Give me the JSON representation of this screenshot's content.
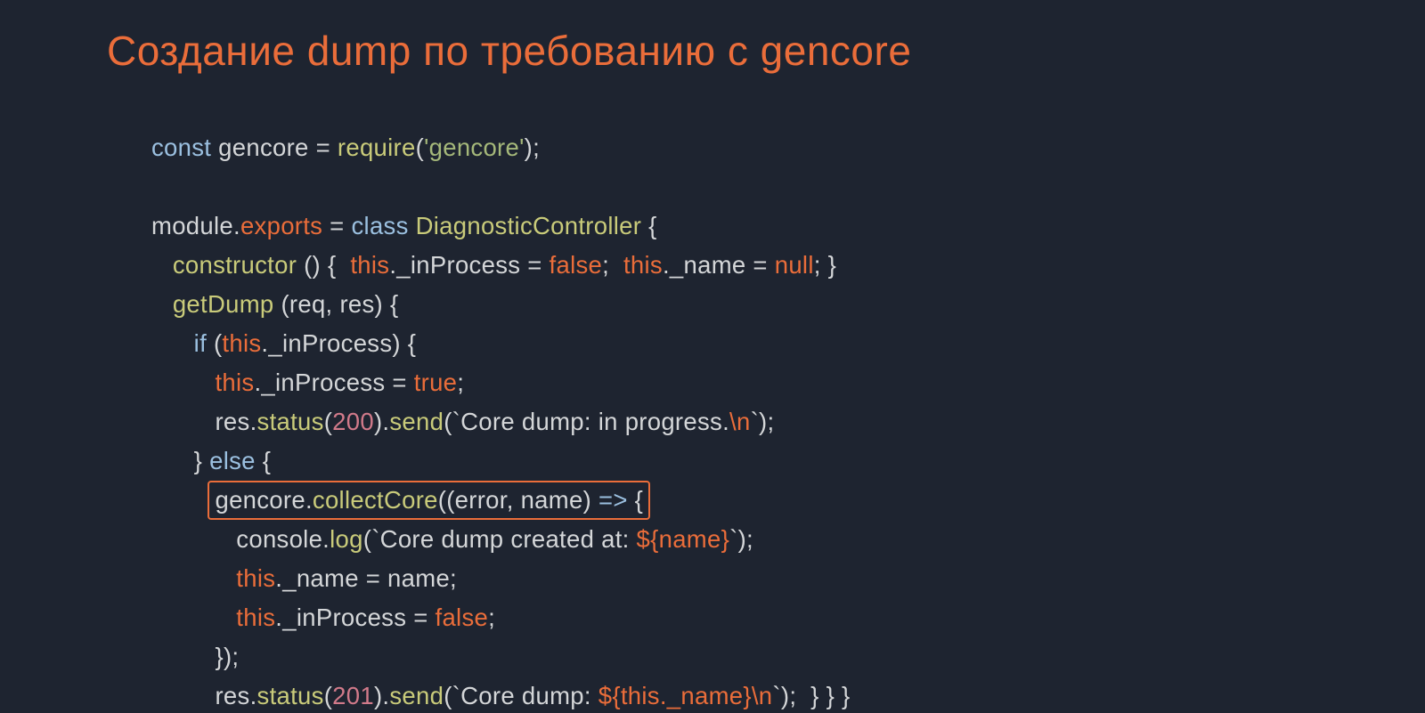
{
  "title": "Создание dump по требованию с gencore",
  "colors": {
    "bg": "#1e2430",
    "accent": "#ea6d3a",
    "keyword": "#9bc0e0",
    "function": "#c9cb7a",
    "number": "#d17a8a",
    "string": "#a5b87a",
    "text": "#d4d6d8"
  },
  "highlight_box_line_index": 9,
  "code_lines": [
    {
      "indent": 0,
      "tokens": [
        {
          "t": "const ",
          "c": "kw"
        },
        {
          "t": "gencore = ",
          "c": "id"
        },
        {
          "t": "require",
          "c": "fn"
        },
        {
          "t": "(",
          "c": "id"
        },
        {
          "t": "'gencore'",
          "c": "strlit"
        },
        {
          "t": ");",
          "c": "id"
        }
      ]
    },
    {
      "indent": 0,
      "tokens": []
    },
    {
      "indent": 0,
      "tokens": [
        {
          "t": "module",
          "c": "mod"
        },
        {
          "t": ".",
          "c": "id"
        },
        {
          "t": "exports",
          "c": "exp"
        },
        {
          "t": " = ",
          "c": "id"
        },
        {
          "t": "class ",
          "c": "kw"
        },
        {
          "t": "DiagnosticController",
          "c": "fn"
        },
        {
          "t": " {",
          "c": "id"
        }
      ]
    },
    {
      "indent": 1,
      "tokens": [
        {
          "t": "constructor",
          "c": "fn"
        },
        {
          "t": " () {  ",
          "c": "id"
        },
        {
          "t": "this",
          "c": "this"
        },
        {
          "t": "._inProcess = ",
          "c": "id"
        },
        {
          "t": "false",
          "c": "bool"
        },
        {
          "t": ";  ",
          "c": "id"
        },
        {
          "t": "this",
          "c": "this"
        },
        {
          "t": "._name = ",
          "c": "id"
        },
        {
          "t": "null",
          "c": "bool"
        },
        {
          "t": "; }",
          "c": "id"
        }
      ]
    },
    {
      "indent": 1,
      "tokens": [
        {
          "t": "getDump",
          "c": "fn"
        },
        {
          "t": " (req, res) {",
          "c": "id"
        }
      ]
    },
    {
      "indent": 2,
      "tokens": [
        {
          "t": "if ",
          "c": "kw"
        },
        {
          "t": "(",
          "c": "id"
        },
        {
          "t": "this",
          "c": "this"
        },
        {
          "t": "._inProcess) {",
          "c": "id"
        }
      ]
    },
    {
      "indent": 3,
      "tokens": [
        {
          "t": "this",
          "c": "this"
        },
        {
          "t": "._inProcess = ",
          "c": "id"
        },
        {
          "t": "true",
          "c": "bool"
        },
        {
          "t": ";",
          "c": "id"
        }
      ]
    },
    {
      "indent": 3,
      "tokens": [
        {
          "t": "res.",
          "c": "id"
        },
        {
          "t": "status",
          "c": "fn"
        },
        {
          "t": "(",
          "c": "id"
        },
        {
          "t": "200",
          "c": "num"
        },
        {
          "t": ").",
          "c": "id"
        },
        {
          "t": "send",
          "c": "fn"
        },
        {
          "t": "(",
          "c": "id"
        },
        {
          "t": "`Core dump: in progress.",
          "c": "str"
        },
        {
          "t": "\\n",
          "c": "esc"
        },
        {
          "t": "`",
          "c": "str"
        },
        {
          "t": ");",
          "c": "id"
        }
      ]
    },
    {
      "indent": 2,
      "tokens": [
        {
          "t": "} ",
          "c": "id"
        },
        {
          "t": "else",
          "c": "kw"
        },
        {
          "t": " {",
          "c": "id"
        }
      ]
    },
    {
      "indent": 3,
      "boxed": true,
      "tokens": [
        {
          "t": "gencore.",
          "c": "id"
        },
        {
          "t": "collectCore",
          "c": "fn"
        },
        {
          "t": "((error, name) ",
          "c": "id"
        },
        {
          "t": "=>",
          "c": "kw"
        },
        {
          "t": " {",
          "c": "id"
        }
      ]
    },
    {
      "indent": 4,
      "tokens": [
        {
          "t": "console.",
          "c": "id"
        },
        {
          "t": "log",
          "c": "fn"
        },
        {
          "t": "(",
          "c": "id"
        },
        {
          "t": "`Core dump created at: ",
          "c": "str"
        },
        {
          "t": "${name}",
          "c": "interp"
        },
        {
          "t": "`",
          "c": "str"
        },
        {
          "t": ");",
          "c": "id"
        }
      ]
    },
    {
      "indent": 4,
      "tokens": [
        {
          "t": "this",
          "c": "this"
        },
        {
          "t": "._name = name;",
          "c": "id"
        }
      ]
    },
    {
      "indent": 4,
      "tokens": [
        {
          "t": "this",
          "c": "this"
        },
        {
          "t": "._inProcess = ",
          "c": "id"
        },
        {
          "t": "false",
          "c": "bool"
        },
        {
          "t": ";",
          "c": "id"
        }
      ]
    },
    {
      "indent": 3,
      "tokens": [
        {
          "t": "});",
          "c": "id"
        }
      ]
    },
    {
      "indent": 3,
      "tokens": [
        {
          "t": "res.",
          "c": "id"
        },
        {
          "t": "status",
          "c": "fn"
        },
        {
          "t": "(",
          "c": "id"
        },
        {
          "t": "201",
          "c": "num"
        },
        {
          "t": ").",
          "c": "id"
        },
        {
          "t": "send",
          "c": "fn"
        },
        {
          "t": "(",
          "c": "id"
        },
        {
          "t": "`Core dump: ",
          "c": "str"
        },
        {
          "t": "${",
          "c": "interp"
        },
        {
          "t": "this",
          "c": "this"
        },
        {
          "t": "._name}",
          "c": "interp"
        },
        {
          "t": "\\n",
          "c": "esc"
        },
        {
          "t": "`",
          "c": "str"
        },
        {
          "t": ");  } } }",
          "c": "id"
        }
      ]
    }
  ]
}
